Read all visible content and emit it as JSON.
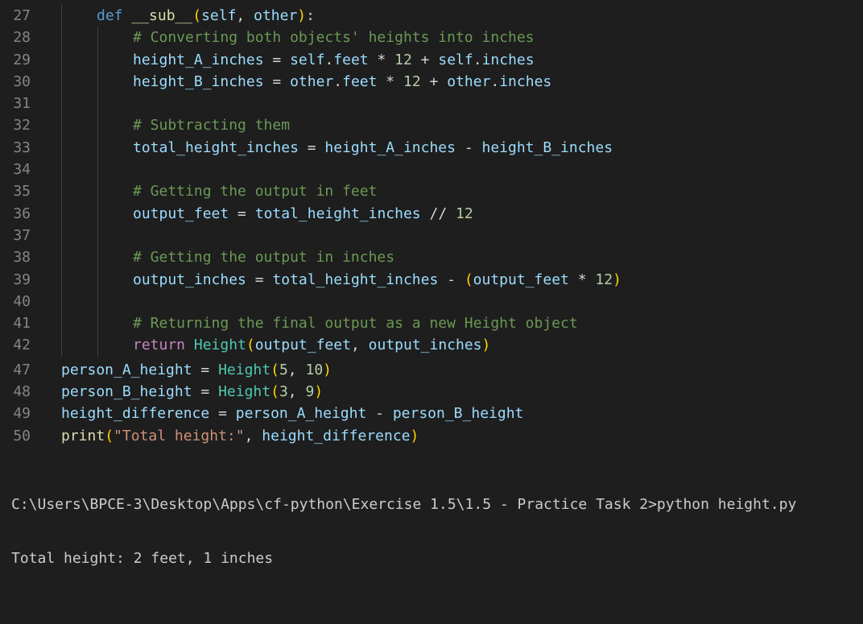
{
  "editor": {
    "lines": [
      {
        "no": "27",
        "tokens": [
          [
            "kw",
            "def "
          ],
          [
            "fn",
            "__sub__"
          ],
          [
            "paren",
            "("
          ],
          [
            "var",
            "self"
          ],
          [
            "op",
            ", "
          ],
          [
            "var",
            "other"
          ],
          [
            "paren",
            ")"
          ],
          [
            "op",
            ":"
          ]
        ]
      },
      {
        "no": "28",
        "tokens": [
          [
            "cmt",
            "# Converting both objects' heights into inches"
          ]
        ]
      },
      {
        "no": "29",
        "tokens": [
          [
            "var",
            "height_A_inches"
          ],
          [
            "op",
            " = "
          ],
          [
            "var",
            "self"
          ],
          [
            "op",
            "."
          ],
          [
            "var",
            "feet"
          ],
          [
            "op",
            " * "
          ],
          [
            "num",
            "12"
          ],
          [
            "op",
            " + "
          ],
          [
            "var",
            "self"
          ],
          [
            "op",
            "."
          ],
          [
            "var",
            "inches"
          ]
        ]
      },
      {
        "no": "30",
        "tokens": [
          [
            "var",
            "height_B_inches"
          ],
          [
            "op",
            " = "
          ],
          [
            "var",
            "other"
          ],
          [
            "op",
            "."
          ],
          [
            "var",
            "feet"
          ],
          [
            "op",
            " * "
          ],
          [
            "num",
            "12"
          ],
          [
            "op",
            " + "
          ],
          [
            "var",
            "other"
          ],
          [
            "op",
            "."
          ],
          [
            "var",
            "inches"
          ]
        ]
      },
      {
        "no": "31",
        "tokens": []
      },
      {
        "no": "32",
        "tokens": [
          [
            "cmt",
            "# Subtracting them"
          ]
        ]
      },
      {
        "no": "33",
        "tokens": [
          [
            "var",
            "total_height_inches"
          ],
          [
            "op",
            " = "
          ],
          [
            "var",
            "height_A_inches"
          ],
          [
            "op",
            " - "
          ],
          [
            "var",
            "height_B_inches"
          ]
        ]
      },
      {
        "no": "34",
        "tokens": []
      },
      {
        "no": "35",
        "tokens": [
          [
            "cmt",
            "# Getting the output in feet"
          ]
        ]
      },
      {
        "no": "36",
        "tokens": [
          [
            "var",
            "output_feet"
          ],
          [
            "op",
            " = "
          ],
          [
            "var",
            "total_height_inches"
          ],
          [
            "op",
            " // "
          ],
          [
            "num",
            "12"
          ]
        ]
      },
      {
        "no": "37",
        "tokens": []
      },
      {
        "no": "38",
        "tokens": [
          [
            "cmt",
            "# Getting the output in inches"
          ]
        ]
      },
      {
        "no": "39",
        "tokens": [
          [
            "var",
            "output_inches"
          ],
          [
            "op",
            " = "
          ],
          [
            "var",
            "total_height_inches"
          ],
          [
            "op",
            " - "
          ],
          [
            "paren",
            "("
          ],
          [
            "var",
            "output_feet"
          ],
          [
            "op",
            " * "
          ],
          [
            "num",
            "12"
          ],
          [
            "paren",
            ")"
          ]
        ]
      },
      {
        "no": "40",
        "tokens": []
      },
      {
        "no": "41",
        "tokens": [
          [
            "cmt",
            "# Returning the final output as a new Height object"
          ]
        ]
      },
      {
        "no": "42",
        "tokens": [
          [
            "kw2",
            "return "
          ],
          [
            "cls",
            "Height"
          ],
          [
            "paren",
            "("
          ],
          [
            "var",
            "output_feet"
          ],
          [
            "op",
            ", "
          ],
          [
            "var",
            "output_inches"
          ],
          [
            "paren",
            ")"
          ]
        ]
      },
      {
        "no": "47",
        "tokens": [
          [
            "var",
            "person_A_height"
          ],
          [
            "op",
            " = "
          ],
          [
            "cls",
            "Height"
          ],
          [
            "paren",
            "("
          ],
          [
            "num",
            "5"
          ],
          [
            "op",
            ", "
          ],
          [
            "num",
            "10"
          ],
          [
            "paren",
            ")"
          ]
        ]
      },
      {
        "no": "48",
        "tokens": [
          [
            "var",
            "person_B_height"
          ],
          [
            "op",
            " = "
          ],
          [
            "cls",
            "Height"
          ],
          [
            "paren",
            "("
          ],
          [
            "num",
            "3"
          ],
          [
            "op",
            ", "
          ],
          [
            "num",
            "9"
          ],
          [
            "paren",
            ")"
          ]
        ]
      },
      {
        "no": "49",
        "tokens": [
          [
            "var",
            "height_difference"
          ],
          [
            "op",
            " = "
          ],
          [
            "var",
            "person_A_height"
          ],
          [
            "op",
            " - "
          ],
          [
            "var",
            "person_B_height"
          ]
        ]
      },
      {
        "no": "50",
        "tokens": [
          [
            "fn",
            "print"
          ],
          [
            "paren",
            "("
          ],
          [
            "str",
            "\"Total height:\""
          ],
          [
            "op",
            ", "
          ],
          [
            "var",
            "height_difference"
          ],
          [
            "paren",
            ")"
          ]
        ]
      }
    ]
  },
  "terminal": {
    "command_line": "C:\\Users\\BPCE-3\\Desktop\\Apps\\cf-python\\Exercise 1.5\\1.5 - Practice Task 2>python height.py",
    "output_line": "Total height: 2 feet, 1 inches"
  },
  "colors": {
    "background": "#1e1e1e",
    "line_number": "#858585",
    "keyword": "#569cd6",
    "control_keyword": "#c586c0",
    "function": "#dcdcaa",
    "variable": "#9cdcfe",
    "class": "#4ec9b0",
    "number": "#b5cea8",
    "string": "#ce9178",
    "comment": "#6a9955",
    "bracket": "#ffd700"
  }
}
